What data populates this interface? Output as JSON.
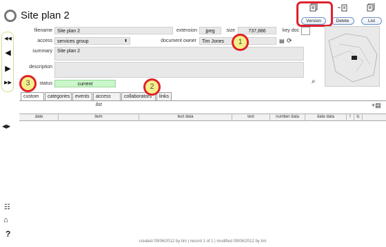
{
  "record": {
    "title": "Site plan 2",
    "filename_label": "filename",
    "filename": "Site plan 2",
    "extension_label": "extension",
    "extension": "jpeg",
    "size_label": "size",
    "size": "737,886",
    "keydoc_label": "key doc",
    "access_label": "access",
    "access": "services group",
    "owner_label": "document owner",
    "owner": "Tim Jones",
    "summary_label": "summary",
    "summary": "Site plan 2",
    "description_label": "description",
    "description": "",
    "status_label": "status",
    "status": "current"
  },
  "header_buttons": {
    "version": "Version",
    "delete": "Delete",
    "list": "List"
  },
  "tabs": [
    "custom",
    "categories",
    "events",
    "access list",
    "collaborators",
    "links"
  ],
  "table_headers": [
    "date",
    "item",
    "text data",
    "text",
    "number data",
    "date data",
    "!",
    "lc"
  ],
  "markers": [
    "1",
    "2",
    "3"
  ],
  "footer": "created 09/06/2012 by tim | record 1 of 1 | modified 09/06/2012 by tim",
  "help": "?",
  "colors": {
    "status_bg": "#c9f7c9",
    "marker_border": "#e0202a",
    "marker_fill": "#f3f08a",
    "nav_outline": "#cfe08a"
  }
}
